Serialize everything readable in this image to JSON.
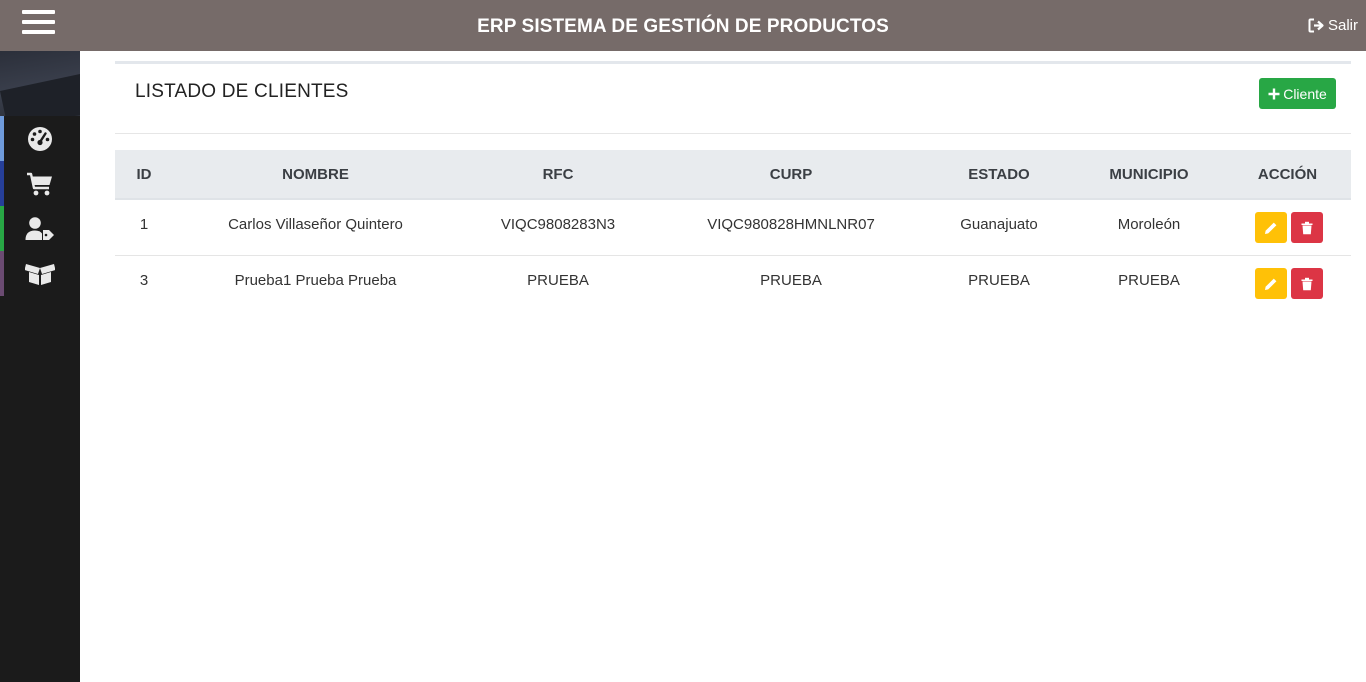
{
  "header": {
    "title": "ERP SISTEMA DE GESTIÓN DE PRODUCTOS",
    "logout_label": "Salir"
  },
  "sidebar": {
    "items": [
      {
        "icon": "dashboard-gauge-icon",
        "accent": "#6f9bdc"
      },
      {
        "icon": "shopping-cart-icon",
        "accent": "#263f99"
      },
      {
        "icon": "user-tag-icon",
        "accent": "#28a745"
      },
      {
        "icon": "box-open-icon",
        "accent": "#6b4b72"
      }
    ]
  },
  "main": {
    "title": "LISTADO DE CLIENTES",
    "add_button_label": "Cliente"
  },
  "table": {
    "columns": [
      "ID",
      "NOMBRE",
      "RFC",
      "CURP",
      "ESTADO",
      "MUNICIPIO",
      "ACCIÓN"
    ],
    "rows": [
      {
        "id": "1",
        "nombre": "Carlos Villaseñor Quintero",
        "rfc": "VIQC9808283N3",
        "curp": "VIQC980828HMNLNR07",
        "estado": "Guanajuato",
        "municipio": "Moroleón"
      },
      {
        "id": "3",
        "nombre": "Prueba1 Prueba Prueba",
        "rfc": "PRUEBA",
        "curp": "PRUEBA",
        "estado": "PRUEBA",
        "municipio": "PRUEBA"
      }
    ]
  },
  "colors": {
    "topbar": "#766b69",
    "sidebar": "#1b1b1b",
    "add_button": "#28a745",
    "edit_button": "#ffc107",
    "delete_button": "#dc3545",
    "table_header": "#e8ebee"
  }
}
